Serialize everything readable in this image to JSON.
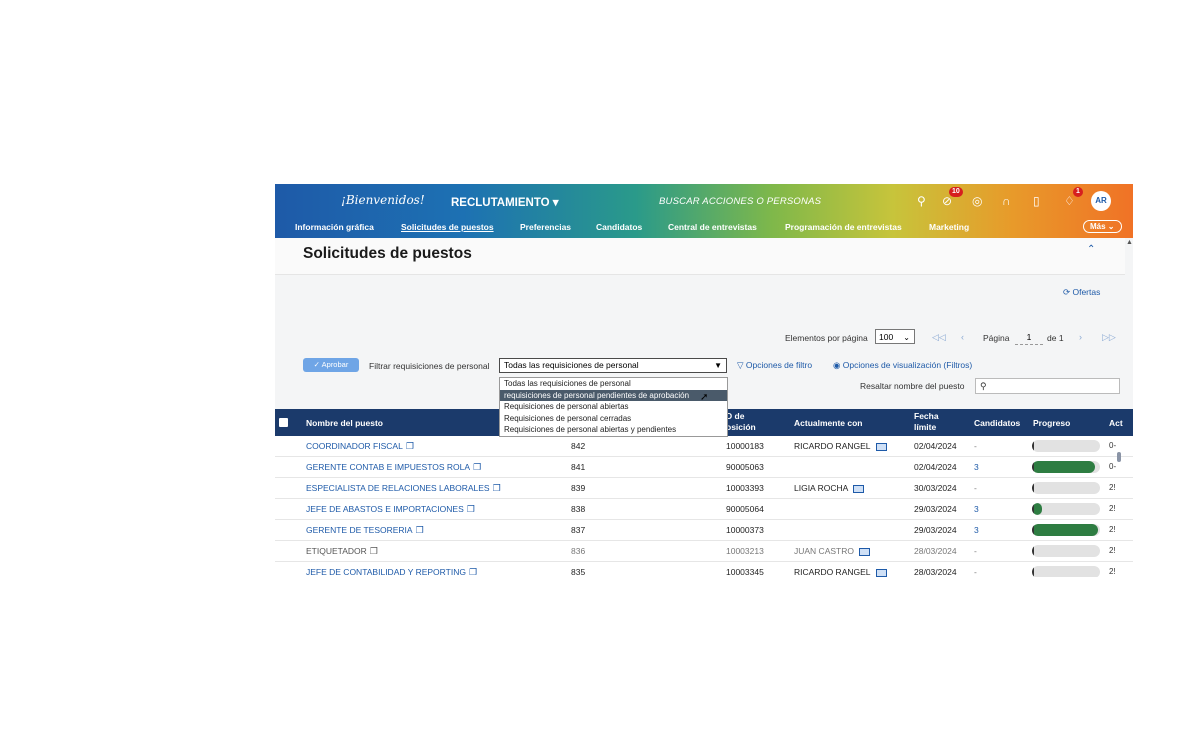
{
  "header": {
    "brand": "¡Bienvenidos!",
    "module": "RECLUTAMIENTO ▾",
    "search_placeholder": "BUSCAR ACCIONES O PERSONAS",
    "badges": {
      "approvals": "10",
      "notifications": "1"
    },
    "avatar": "AR"
  },
  "nav": {
    "items": [
      "Información gráfica",
      "Solicitudes de puestos",
      "Preferencias",
      "Candidatos",
      "Central de entrevistas",
      "Programación de entrevistas",
      "Marketing"
    ],
    "active": "Solicitudes de puestos",
    "more": "Más ⌄"
  },
  "page": {
    "title": "Solicitudes de puestos",
    "ofertas": "Ofertas"
  },
  "pagination": {
    "per_page_label": "Elementos por página",
    "per_page_value": "100",
    "page_label": "Página",
    "page_value": "1",
    "of_label": "de 1"
  },
  "filters": {
    "approve_button": "Aprobar",
    "filter_label": "Filtrar requisiciones de personal",
    "selected": "Todas las requisiciones de personal",
    "options": [
      "Todas las requisiciones de personal",
      "requisiciones de personal pendientes de aprobación",
      "Requisiciones de personal abiertas",
      "Requisiciones de personal cerradas",
      "Requisiciones de personal abiertas y pendientes"
    ],
    "highlighted_option_index": 1,
    "filter_options_link": "Opciones de filtro",
    "view_options_link": "Opciones de visualización (Filtros)",
    "highlight_label": "Resaltar nombre del puesto"
  },
  "table": {
    "headers": {
      "name": "Nombre del puesto",
      "id": "D de\nosición",
      "current": "Actualmente con",
      "due": "Fecha\nlímite",
      "candidates": "Candidatos",
      "progress": "Progreso",
      "actions": "Act"
    },
    "rows": [
      {
        "name": "COORDINADOR FISCAL",
        "num": "842",
        "id": "10000183",
        "current": "RICARDO RANGEL",
        "due": "02/04/2024",
        "candidates": "-",
        "progress": 0.0,
        "extra": "0-"
      },
      {
        "name": "GERENTE CONTAB E IMPUESTOS ROLA",
        "num": "841",
        "id": "90005063",
        "current": "",
        "due": "02/04/2024",
        "candidates": "3",
        "progress": 0.92,
        "extra": "0-"
      },
      {
        "name": "ESPECIALISTA DE RELACIONES LABORALES",
        "num": "839",
        "id": "10003393",
        "current": "LIGIA ROCHA",
        "due": "30/03/2024",
        "candidates": "-",
        "progress": 0.0,
        "extra": "2!"
      },
      {
        "name": "JEFE DE ABASTOS E IMPORTACIONES",
        "num": "838",
        "id": "90005064",
        "current": "",
        "due": "29/03/2024",
        "candidates": "3",
        "progress": 0.15,
        "extra": "2!"
      },
      {
        "name": "GERENTE DE TESORERIA",
        "num": "837",
        "id": "10000373",
        "current": "",
        "due": "29/03/2024",
        "candidates": "3",
        "progress": 0.97,
        "extra": "2!"
      },
      {
        "name": "ETIQUETADOR",
        "num": "836",
        "id": "10003213",
        "current": "JUAN CASTRO",
        "due": "28/03/2024",
        "candidates": "-",
        "progress": 0.0,
        "extra": "2!"
      },
      {
        "name": "JEFE DE CONTABILIDAD Y REPORTING",
        "num": "835",
        "id": "10003345",
        "current": "RICARDO RANGEL",
        "due": "28/03/2024",
        "candidates": "-",
        "progress": 0.0,
        "extra": "2!"
      }
    ]
  }
}
